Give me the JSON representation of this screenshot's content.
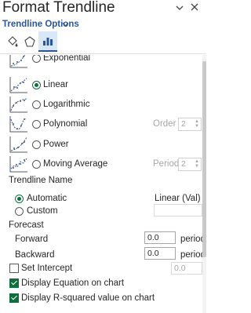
{
  "pane": {
    "title": "Format Trendline",
    "tab_label": "Trendline Options"
  },
  "icons": {
    "header_collapse": "chevron-down-icon",
    "close": "close-icon",
    "fill_line": "paint-bucket-icon",
    "effects": "pentagon-icon",
    "trendline_options": "bar-chart-icon"
  },
  "trend_types": [
    {
      "label": "Exponential",
      "selected": false,
      "icon": "exponential-icon"
    },
    {
      "label": "Linear",
      "selected": true,
      "icon": "linear-icon"
    },
    {
      "label": "Logarithmic",
      "selected": false,
      "icon": "logarithmic-icon"
    },
    {
      "label": "Polynomial",
      "selected": false,
      "icon": "polynomial-icon",
      "param_label": "Order",
      "param_value": "2"
    },
    {
      "label": "Power",
      "selected": false,
      "icon": "power-icon"
    },
    {
      "label": "Moving Average",
      "selected": false,
      "icon": "moving-average-icon",
      "param_label": "Period",
      "param_value": "2"
    }
  ],
  "trendline_name": {
    "section_label": "Trendline Name",
    "automatic_label": "Automatic",
    "automatic_value": "Linear (Val)",
    "custom_label": "Custom",
    "custom_value": ""
  },
  "forecast": {
    "section_label": "Forecast",
    "forward_label": "Forward",
    "forward_value": "0.0",
    "backward_label": "Backward",
    "backward_value": "0.0",
    "unit": "periods"
  },
  "set_intercept": {
    "label": "Set Intercept",
    "checked": false,
    "value": "0.0"
  },
  "display_equation": {
    "label": "Display Equation on chart",
    "checked": true
  },
  "display_r2": {
    "label": "Display R-squared value on chart",
    "checked": true
  },
  "colors": {
    "accent": "#0f6e3d",
    "tab": "#2b579a",
    "selected_tab_bg": "#d9e8f7"
  }
}
